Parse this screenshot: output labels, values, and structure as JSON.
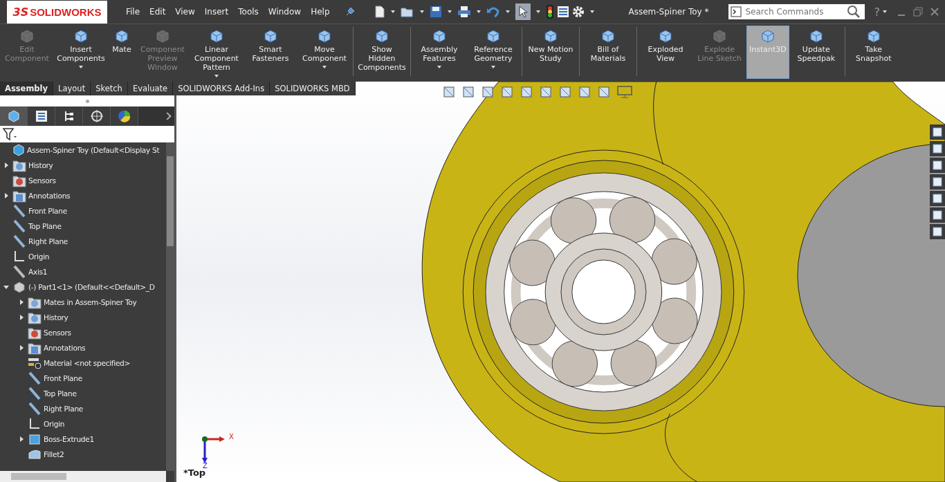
{
  "app": {
    "logo": "SOLIDWORKS",
    "logo_prefix": "3S"
  },
  "menu": [
    "File",
    "Edit",
    "View",
    "Insert",
    "Tools",
    "Window",
    "Help"
  ],
  "window": {
    "title": "Assem-Spiner Toy *",
    "help": "?"
  },
  "search": {
    "placeholder": "Search Commands"
  },
  "ribbon_groups": [
    {
      "buttons": [
        {
          "label": "Edit Component",
          "disabled": true,
          "selected": false,
          "dropdown": false
        },
        {
          "label": "Insert Components",
          "disabled": false,
          "selected": false,
          "dropdown": true
        },
        {
          "label": "Mate",
          "disabled": false,
          "selected": false,
          "dropdown": false
        },
        {
          "label": "Component Preview Window",
          "disabled": true,
          "selected": false,
          "dropdown": false
        },
        {
          "label": "Linear Component Pattern",
          "disabled": false,
          "selected": false,
          "dropdown": true
        },
        {
          "label": "Smart Fasteners",
          "disabled": false,
          "selected": false,
          "dropdown": false
        },
        {
          "label": "Move Component",
          "disabled": false,
          "selected": false,
          "dropdown": true
        }
      ]
    },
    {
      "buttons": [
        {
          "label": "Show Hidden Components",
          "disabled": false,
          "selected": false,
          "dropdown": false
        }
      ]
    },
    {
      "buttons": [
        {
          "label": "Assembly Features",
          "disabled": false,
          "selected": false,
          "dropdown": true
        },
        {
          "label": "Reference Geometry",
          "disabled": false,
          "selected": false,
          "dropdown": true
        }
      ]
    },
    {
      "buttons": [
        {
          "label": "New Motion Study",
          "disabled": false,
          "selected": false,
          "dropdown": false
        }
      ]
    },
    {
      "buttons": [
        {
          "label": "Bill of Materials",
          "disabled": false,
          "selected": false,
          "dropdown": false
        }
      ]
    },
    {
      "buttons": [
        {
          "label": "Exploded View",
          "disabled": false,
          "selected": false,
          "dropdown": false
        },
        {
          "label": "Explode Line Sketch",
          "disabled": true,
          "selected": false,
          "dropdown": false
        },
        {
          "label": "Instant3D",
          "disabled": false,
          "selected": true,
          "dropdown": false
        },
        {
          "label": "Update Speedpak",
          "disabled": false,
          "selected": false,
          "dropdown": false
        }
      ]
    },
    {
      "buttons": [
        {
          "label": "Take Snapshot",
          "disabled": false,
          "selected": false,
          "dropdown": false
        }
      ]
    }
  ],
  "command_tabs": [
    {
      "label": "Assembly",
      "selected": true
    },
    {
      "label": "Layout",
      "selected": false
    },
    {
      "label": "Sketch",
      "selected": false
    },
    {
      "label": "Evaluate",
      "selected": false
    },
    {
      "label": "SOLIDWORKS Add-Ins",
      "selected": false
    },
    {
      "label": "SOLIDWORKS MBD",
      "selected": false
    }
  ],
  "panel_tabs": [
    {
      "kind": "feature",
      "selected": true
    },
    {
      "kind": "property",
      "selected": false
    },
    {
      "kind": "config",
      "selected": false
    },
    {
      "kind": "dimxpert",
      "selected": false
    },
    {
      "kind": "display",
      "selected": false
    }
  ],
  "tree": {
    "label": "Assem-Spiner Toy  (Default<Display St",
    "kind": "assembly",
    "children": [
      {
        "label": "History",
        "kind": "history",
        "expanded": false
      },
      {
        "label": "Sensors",
        "kind": "sensors"
      },
      {
        "label": "Annotations",
        "kind": "annotations",
        "expanded": false
      },
      {
        "label": "Front Plane",
        "kind": "plane"
      },
      {
        "label": "Top Plane",
        "kind": "plane"
      },
      {
        "label": "Right Plane",
        "kind": "plane"
      },
      {
        "label": "Origin",
        "kind": "origin"
      },
      {
        "label": "Axis1",
        "kind": "axis"
      },
      {
        "label": "(-) Part1<1> (Default<<Default>_D",
        "kind": "part",
        "expanded": true,
        "children": [
          {
            "label": "Mates in Assem-Spiner Toy",
            "kind": "mates",
            "expanded": false
          },
          {
            "label": "History",
            "kind": "history",
            "expanded": false
          },
          {
            "label": "Sensors",
            "kind": "sensors"
          },
          {
            "label": "Annotations",
            "kind": "annotations",
            "expanded": false
          },
          {
            "label": "Material <not specified>",
            "kind": "material"
          },
          {
            "label": "Front Plane",
            "kind": "plane"
          },
          {
            "label": "Top Plane",
            "kind": "plane"
          },
          {
            "label": "Right Plane",
            "kind": "plane"
          },
          {
            "label": "Origin",
            "kind": "origin"
          },
          {
            "label": "Boss-Extrude1",
            "kind": "extrude",
            "expanded": false
          },
          {
            "label": "Fillet2",
            "kind": "fillet"
          }
        ]
      }
    ]
  },
  "viewport": {
    "view_label": "*Top",
    "triad": {
      "x": "X",
      "z": "Z"
    }
  }
}
